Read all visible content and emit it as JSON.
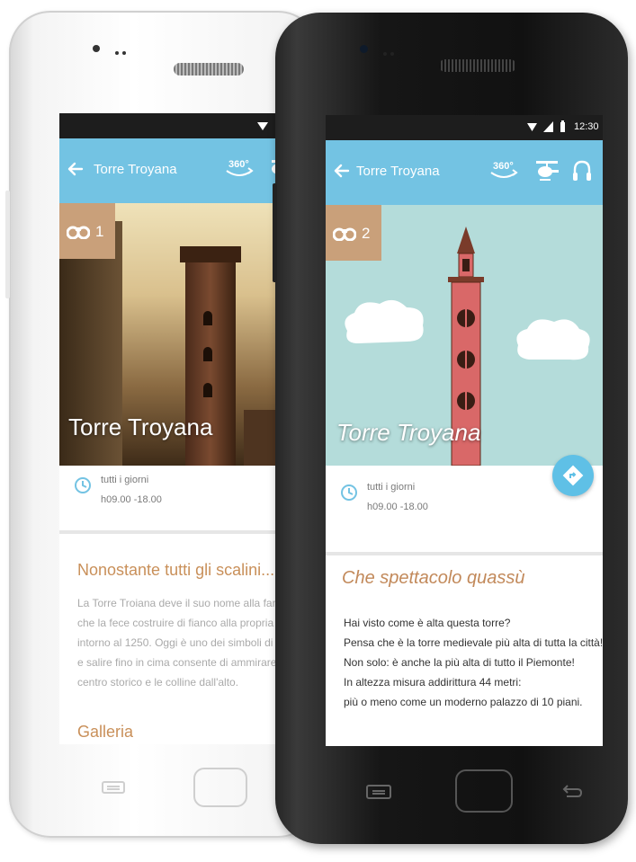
{
  "screens": {
    "white": {
      "back_title": "Torre Troyana",
      "badge_number": "1",
      "hero_title": "Torre Troyana",
      "hours_days": "tutti i giorni",
      "hours_time": "h09.00 -18.00",
      "section_title": "Nonostante tutti gli scalini...",
      "body_lines": [
        "La Torre Troiana deve il suo nome alla famiglia",
        "che la fece costruire di fianco alla propria resid.",
        "intorno al 1250. Oggi è uno dei simboli di Asti",
        "e salire fino in cima consente di ammirare il",
        "centro storico e le colline dall'alto."
      ],
      "gallery_title": "Galleria",
      "icons": {
        "back": "arrow-left-icon",
        "view360": "360-view-icon",
        "badge": "binoculars-icon",
        "clock": "clock-icon"
      }
    },
    "black": {
      "status_time": "12:30",
      "back_title": "Torre Troyana",
      "badge_number": "2",
      "hero_title": "Torre Troyana",
      "hours_days": "tutti i giorni",
      "hours_time": "h09.00 -18.00",
      "section_title": "Che spettacolo quassù",
      "body_lines": [
        "Hai visto come è alta questa torre?",
        "Pensa che è la torre medievale più alta di tutta la città!",
        "Non solo: è anche la più alta di tutto il Piemonte!",
        "In altezza misura addirittura 44 metri:",
        "più o meno come un moderno palazzo di 10 piani."
      ],
      "icons": {
        "back": "arrow-left-icon",
        "view360": "360-view-icon",
        "helicopter": "helicopter-icon",
        "audio": "headphones-icon",
        "badge": "binoculars-icon",
        "clock": "clock-icon",
        "directions": "directions-icon"
      }
    }
  },
  "colors": {
    "accent": "#73c3e3",
    "badge": "#c9a07a",
    "section_title": "#c9905a",
    "fab": "#5fc0e6"
  }
}
